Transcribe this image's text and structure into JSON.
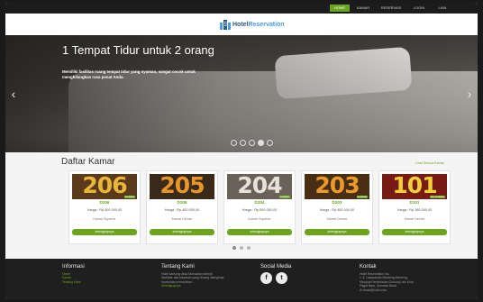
{
  "nav": {
    "items": [
      {
        "label": "HOME",
        "active": true
      },
      {
        "label": "KAMAR",
        "active": false
      },
      {
        "label": "RESERVASI",
        "active": false
      },
      {
        "label": "LOGIN",
        "active": false
      },
      {
        "label": "LAIN",
        "active": false
      }
    ]
  },
  "brand": {
    "name_dark": "Hotel",
    "name_accent": "Reservation",
    "icon": "hotel-icon"
  },
  "hero": {
    "title": "1 Tempat Tidur untuk 2 orang",
    "description": "Memiliki fasilitas ruang tempat tidur yang nyaman, sangat cocok untuk menghilangkan rasa penat Anda."
  },
  "rooms": {
    "title": "Daftar Kamar",
    "view_all": "Lihat Semua Kamar",
    "items": [
      {
        "number": "206",
        "code": "D206",
        "price": "Harga : Rp.500.000,00",
        "type": "Kamar Superior",
        "button": "selengkapnya",
        "tag": "Available",
        "num_color": "#e8b73a",
        "bg": "#5a3a1a"
      },
      {
        "number": "205",
        "code": "D205",
        "price": "Harga : Rp.400.000,00",
        "type": "Kamar Deluxe",
        "button": "selengkapnya",
        "tag": "",
        "num_color": "#e8962a",
        "bg": "#3a2a1a"
      },
      {
        "number": "204",
        "code": "D204",
        "price": "Harga : Rp.500.000,00",
        "type": "Kamar Superior",
        "button": "selengkapnya",
        "tag": "Available",
        "num_color": "#e6e2d8",
        "bg": "#6a6258"
      },
      {
        "number": "203",
        "code": "D203",
        "price": "Harga : Rp.450.000,00",
        "type": "Kamar Deluxe",
        "button": "selengkapnya",
        "tag": "Available",
        "num_color": "#e89a2a",
        "bg": "#4a2e14"
      },
      {
        "number": "101",
        "code": "D101",
        "price": "Harga : Rp.185.000,00",
        "type": "Kamar Deluxe",
        "button": "selengkapnya",
        "tag": "Not Available",
        "num_color": "#f0d03a",
        "bg": "#7a1a14"
      }
    ]
  },
  "footer": {
    "informasi": {
      "title": "Informasi",
      "links": [
        "Home",
        "Kamar",
        "Tentang Kami"
      ]
    },
    "tentang": {
      "title": "Tentang Kami",
      "text": [
        "Hotel kamong desa Manusilan terletal",
        "disekitar dari kawasan yang tenang dilengkapi",
        "komunitas memainkan..."
      ],
      "link": "Selengkapnya"
    },
    "sosial": {
      "title": "Social Media",
      "icons": [
        "facebook-icon",
        "twitter-icon"
      ]
    },
    "kontak": {
      "title": "Kontak",
      "lines": [
        "Hotel Reservation Inc.",
        "Jl. Lasacanalu Menteng Menteng,",
        "Kampus Pendekatan Gubung Lain Kota",
        "Pagar Baru, Sumatra Barat",
        "email@hotel.com"
      ]
    }
  },
  "colors": {
    "accent": "#6aa51d",
    "dark": "#1f1f1f",
    "brand": "#2a5a8a"
  }
}
